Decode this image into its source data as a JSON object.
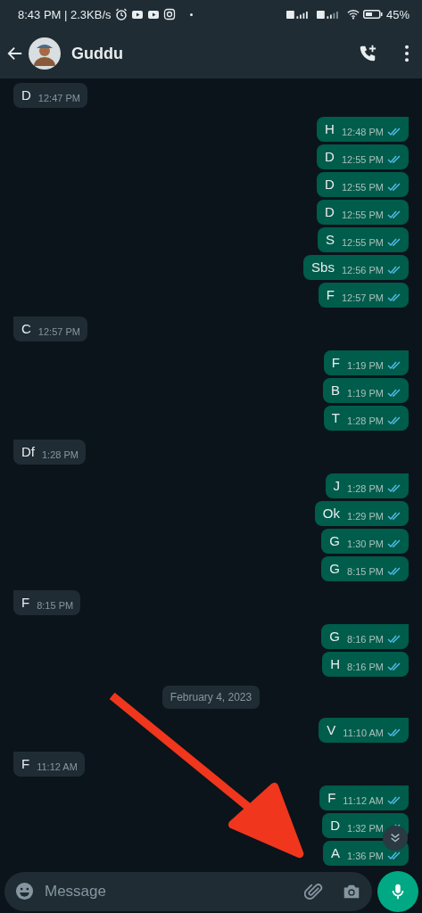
{
  "status_bar": {
    "time": "8:43 PM | 2.3KB/s",
    "battery": "45%"
  },
  "header": {
    "contact_name": "Guddu"
  },
  "messages": [
    {
      "kind": "message",
      "outgoing": false,
      "text": "D",
      "time": "12:47 PM",
      "tail": false
    },
    {
      "kind": "message",
      "outgoing": true,
      "text": "H",
      "time": "12:48 PM",
      "read": true,
      "tail": true
    },
    {
      "kind": "message",
      "outgoing": true,
      "text": "D",
      "time": "12:55 PM",
      "read": true,
      "tail": false
    },
    {
      "kind": "message",
      "outgoing": true,
      "text": "D",
      "time": "12:55 PM",
      "read": true,
      "tail": false
    },
    {
      "kind": "message",
      "outgoing": true,
      "text": "D",
      "time": "12:55 PM",
      "read": true,
      "tail": false
    },
    {
      "kind": "message",
      "outgoing": true,
      "text": "S",
      "time": "12:55 PM",
      "read": true,
      "tail": false
    },
    {
      "kind": "message",
      "outgoing": true,
      "text": "Sbs",
      "time": "12:56 PM",
      "read": true,
      "tail": false
    },
    {
      "kind": "message",
      "outgoing": true,
      "text": "F",
      "time": "12:57 PM",
      "read": true,
      "tail": false
    },
    {
      "kind": "message",
      "outgoing": false,
      "text": "C",
      "time": "12:57 PM",
      "tail": true
    },
    {
      "kind": "message",
      "outgoing": true,
      "text": "F",
      "time": "1:19 PM",
      "read": true,
      "tail": true
    },
    {
      "kind": "message",
      "outgoing": true,
      "text": "B",
      "time": "1:19 PM",
      "read": true,
      "tail": false
    },
    {
      "kind": "message",
      "outgoing": true,
      "text": "T",
      "time": "1:28 PM",
      "read": true,
      "tail": false
    },
    {
      "kind": "message",
      "outgoing": false,
      "text": "Df",
      "time": "1:28 PM",
      "tail": true
    },
    {
      "kind": "message",
      "outgoing": true,
      "text": "J",
      "time": "1:28 PM",
      "read": true,
      "tail": true
    },
    {
      "kind": "message",
      "outgoing": true,
      "text": "Ok",
      "time": "1:29 PM",
      "read": true,
      "tail": false
    },
    {
      "kind": "message",
      "outgoing": true,
      "text": "G",
      "time": "1:30 PM",
      "read": true,
      "tail": false
    },
    {
      "kind": "message",
      "outgoing": true,
      "text": "G",
      "time": "8:15 PM",
      "read": true,
      "tail": false
    },
    {
      "kind": "message",
      "outgoing": false,
      "text": "F",
      "time": "8:15 PM",
      "tail": true
    },
    {
      "kind": "message",
      "outgoing": true,
      "text": "G",
      "time": "8:16 PM",
      "read": true,
      "tail": true
    },
    {
      "kind": "message",
      "outgoing": true,
      "text": "H",
      "time": "8:16 PM",
      "read": true,
      "tail": false
    },
    {
      "kind": "date",
      "text": "February 4, 2023"
    },
    {
      "kind": "message",
      "outgoing": true,
      "text": "V",
      "time": "11:10 AM",
      "read": true,
      "tail": true
    },
    {
      "kind": "message",
      "outgoing": false,
      "text": "F",
      "time": "11:12 AM",
      "tail": true
    },
    {
      "kind": "message",
      "outgoing": true,
      "text": "F",
      "time": "11:12 AM",
      "read": true,
      "tail": true
    },
    {
      "kind": "message",
      "outgoing": true,
      "text": "D",
      "time": "1:32 PM",
      "read": true,
      "tail": false
    },
    {
      "kind": "message",
      "outgoing": true,
      "text": "A",
      "time": "1:36 PM",
      "read": true,
      "tail": false
    }
  ],
  "composer": {
    "placeholder": "Message"
  }
}
